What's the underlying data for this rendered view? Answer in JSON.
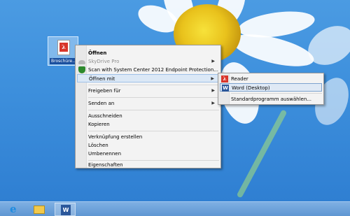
{
  "desktop_icon": {
    "label": "Broschüre...",
    "icon": "pdf-document-icon"
  },
  "context_menu": {
    "items": [
      {
        "label": "Öffnen",
        "bold": true
      },
      {
        "label": "SkyDrive Pro",
        "disabled": true,
        "submenu": true,
        "icon": "skydrive-icon"
      },
      {
        "label": "Scan with System Center 2012 Endpoint Protection...",
        "icon": "shield-icon"
      },
      {
        "label": "Öffnen mit",
        "submenu": true,
        "highlighted": true
      },
      {
        "label": "Freigeben für",
        "submenu": true
      },
      {
        "label": "Senden an",
        "submenu": true
      },
      {
        "label": "Ausschneiden"
      },
      {
        "label": "Kopieren"
      },
      {
        "label": "Verknüpfung erstellen"
      },
      {
        "label": "Löschen"
      },
      {
        "label": "Umbenennen"
      },
      {
        "label": "Eigenschaften"
      }
    ]
  },
  "open_with_submenu": {
    "items": [
      {
        "label": "Reader",
        "icon": "adobe-reader-icon"
      },
      {
        "label": "Word (Desktop)",
        "icon": "word-icon",
        "highlighted": true
      },
      {
        "label": "Standardprogramm auswählen..."
      }
    ]
  },
  "taskbar": {
    "buttons": [
      {
        "name": "internet-explorer-icon",
        "glyph": "e"
      },
      {
        "name": "file-explorer-icon",
        "glyph": ""
      },
      {
        "name": "word-icon",
        "glyph": "W"
      }
    ]
  },
  "colors": {
    "accent": "#1a4f9e",
    "desktop_bg": "#3d8fdc",
    "menu_bg": "#f3f3f3",
    "highlight": "#dbe8f6"
  }
}
